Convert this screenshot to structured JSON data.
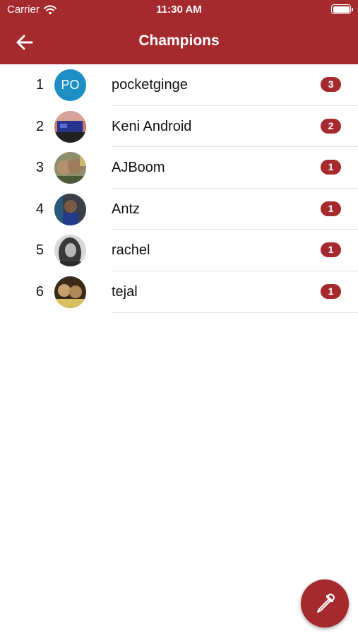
{
  "status_bar": {
    "carrier": "Carrier",
    "time": "11:30 AM"
  },
  "header": {
    "title": "Champions",
    "back_icon": "arrow-left-icon"
  },
  "theme": {
    "accent": "#a52a2e",
    "initials_bg": "#1e8fc4"
  },
  "champions": [
    {
      "rank": "1",
      "initials": "PO",
      "name": "pocketginge",
      "count": "3"
    },
    {
      "rank": "2",
      "name": "Keni Android",
      "count": "2"
    },
    {
      "rank": "3",
      "name": "AJBoom",
      "count": "1"
    },
    {
      "rank": "4",
      "name": "Antz",
      "count": "1"
    },
    {
      "rank": "5",
      "name": "rachel",
      "count": "1"
    },
    {
      "rank": "6",
      "name": "tejal",
      "count": "1"
    }
  ],
  "fab": {
    "icon": "eyedropper-icon"
  }
}
